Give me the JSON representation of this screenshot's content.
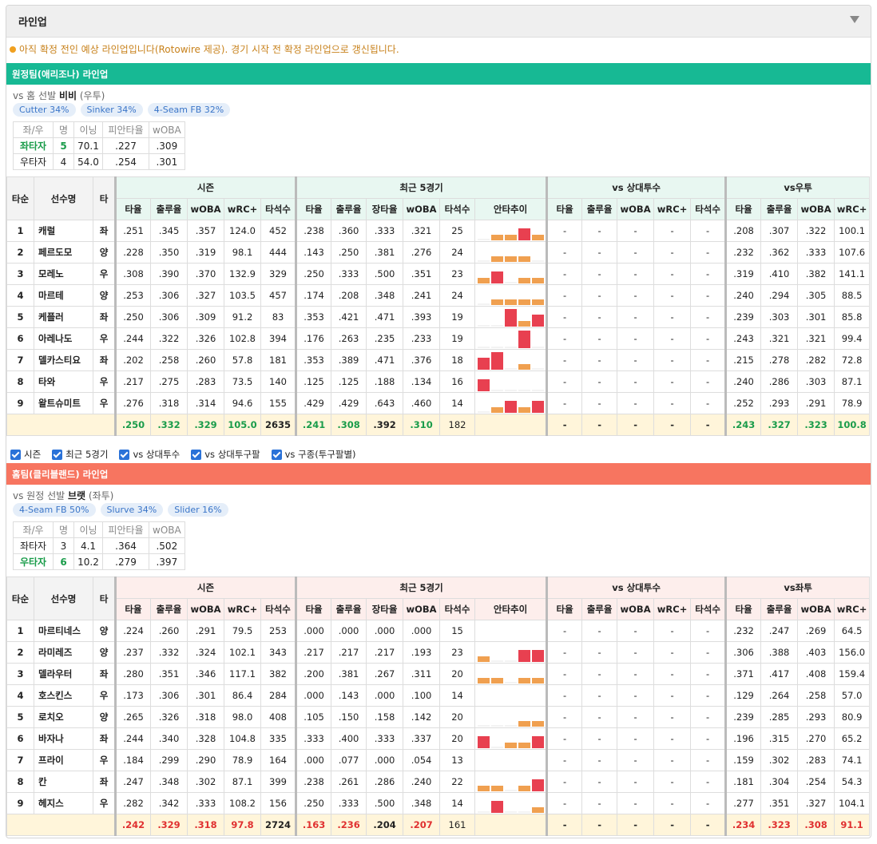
{
  "header": {
    "title": "라인업"
  },
  "notice": "아직 확정 전인 예상 라인업입니다(Rotowire 제공). 경기 시작 전 확정 라인업으로 갱신됩니다.",
  "filters": [
    "시즌",
    "최근 5경기",
    "vs 상대투수",
    "vs 상대투구팔",
    "vs 구종(투구팔별)"
  ],
  "colors": {
    "away_accent": "#17b994",
    "home_accent": "#f77560",
    "good": "#1a9c4a",
    "bad": "#e03030"
  },
  "table_headers": {
    "order": "타순",
    "player": "선수명",
    "bats": "타",
    "groups": [
      "시즌",
      "최근 5경기",
      "vs 상대투수"
    ],
    "season_cols": [
      "타율",
      "출루율",
      "wOBA",
      "wRC+",
      "타석수"
    ],
    "recent_cols": [
      "타율",
      "출루율",
      "장타율",
      "wOBA",
      "타석수",
      "안타추이"
    ],
    "vsp_cols": [
      "타율",
      "출루율",
      "wOBA",
      "wRC+",
      "타석수"
    ],
    "hand_cols": [
      "타율",
      "출루율",
      "wOBA",
      "wRC+"
    ],
    "split_cols": [
      "좌/우",
      "명",
      "이닝",
      "피안타율",
      "wOBA"
    ]
  },
  "away": {
    "title": "원정팀(애리조나) 라인업",
    "vs_prefix": "vs 홈 선발",
    "pitcher": "비비",
    "pitcher_hand": "(우투)",
    "pitches": [
      "Cutter 34%",
      "Sinker 34%",
      "4-Seam FB 32%"
    ],
    "hand_group": "vs우투",
    "splits": [
      {
        "side": "좌타자",
        "count": "5",
        "ip": "70.1",
        "avg": ".227",
        "woba": ".309",
        "highlight": true
      },
      {
        "side": "우타자",
        "count": "4",
        "ip": "54.0",
        "avg": ".254",
        "woba": ".301",
        "highlight": false
      }
    ],
    "players": [
      {
        "order": "1",
        "name": "캐럴",
        "bats": "좌",
        "season": [
          ".251",
          ".345",
          ".357",
          "124.0",
          "452"
        ],
        "recent": [
          ".238",
          ".360",
          ".333",
          ".321",
          "25"
        ],
        "trend": [
          0,
          1,
          1,
          2,
          1
        ],
        "vsp": [
          "-",
          "-",
          "-",
          "-",
          "-"
        ],
        "hand": [
          ".208",
          ".307",
          ".322",
          "100.1"
        ]
      },
      {
        "order": "2",
        "name": "페르도모",
        "bats": "양",
        "season": [
          ".228",
          ".350",
          ".319",
          "98.1",
          "444"
        ],
        "recent": [
          ".143",
          ".250",
          ".381",
          ".276",
          "24"
        ],
        "trend": [
          0,
          1,
          1,
          1,
          0
        ],
        "vsp": [
          "-",
          "-",
          "-",
          "-",
          "-"
        ],
        "hand": [
          ".232",
          ".362",
          ".333",
          "107.6"
        ]
      },
      {
        "order": "3",
        "name": "모레노",
        "bats": "우",
        "season": [
          ".308",
          ".390",
          ".370",
          "132.9",
          "329"
        ],
        "recent": [
          ".250",
          ".333",
          ".500",
          ".351",
          "23"
        ],
        "trend": [
          1,
          2,
          0,
          1,
          1
        ],
        "vsp": [
          "-",
          "-",
          "-",
          "-",
          "-"
        ],
        "hand": [
          ".319",
          ".410",
          ".382",
          "141.1"
        ]
      },
      {
        "order": "4",
        "name": "마르테",
        "bats": "양",
        "season": [
          ".253",
          ".306",
          ".327",
          "103.5",
          "457"
        ],
        "recent": [
          ".174",
          ".208",
          ".348",
          ".241",
          "24"
        ],
        "trend": [
          0,
          1,
          1,
          1,
          1
        ],
        "vsp": [
          "-",
          "-",
          "-",
          "-",
          "-"
        ],
        "hand": [
          ".240",
          ".294",
          ".305",
          "88.5"
        ]
      },
      {
        "order": "5",
        "name": "케플러",
        "bats": "좌",
        "season": [
          ".250",
          ".306",
          ".309",
          "91.2",
          "83"
        ],
        "recent": [
          ".353",
          ".421",
          ".471",
          ".393",
          "19"
        ],
        "trend": [
          0,
          0,
          3,
          1,
          2
        ],
        "vsp": [
          "-",
          "-",
          "-",
          "-",
          "-"
        ],
        "hand": [
          ".239",
          ".303",
          ".301",
          "85.8"
        ]
      },
      {
        "order": "6",
        "name": "아레나도",
        "bats": "우",
        "season": [
          ".244",
          ".322",
          ".326",
          "102.8",
          "394"
        ],
        "recent": [
          ".176",
          ".263",
          ".235",
          ".233",
          "19"
        ],
        "trend": [
          0,
          0,
          0,
          3,
          0
        ],
        "vsp": [
          "-",
          "-",
          "-",
          "-",
          "-"
        ],
        "hand": [
          ".243",
          ".321",
          ".321",
          "99.4"
        ]
      },
      {
        "order": "7",
        "name": "델카스티요",
        "bats": "좌",
        "season": [
          ".202",
          ".258",
          ".260",
          "57.8",
          "181"
        ],
        "recent": [
          ".353",
          ".389",
          ".471",
          ".376",
          "18"
        ],
        "trend": [
          2,
          3,
          0,
          1,
          0
        ],
        "vsp": [
          "-",
          "-",
          "-",
          "-",
          "-"
        ],
        "hand": [
          ".215",
          ".278",
          ".282",
          "72.8"
        ]
      },
      {
        "order": "8",
        "name": "타와",
        "bats": "우",
        "season": [
          ".217",
          ".275",
          ".283",
          "73.5",
          "140"
        ],
        "recent": [
          ".125",
          ".125",
          ".188",
          ".134",
          "16"
        ],
        "trend": [
          2,
          0,
          0,
          0,
          0
        ],
        "vsp": [
          "-",
          "-",
          "-",
          "-",
          "-"
        ],
        "hand": [
          ".240",
          ".286",
          ".303",
          "87.1"
        ]
      },
      {
        "order": "9",
        "name": "왈트슈미트",
        "bats": "우",
        "season": [
          ".276",
          ".318",
          ".314",
          "94.6",
          "155"
        ],
        "recent": [
          ".429",
          ".429",
          ".643",
          ".460",
          "14"
        ],
        "trend": [
          0,
          1,
          2,
          1,
          2
        ],
        "vsp": [
          "-",
          "-",
          "-",
          "-",
          "-"
        ],
        "hand": [
          ".252",
          ".293",
          ".291",
          "78.9"
        ]
      }
    ],
    "total": {
      "season": [
        ".250",
        ".332",
        ".329",
        "105.0",
        "2635"
      ],
      "recent": [
        ".241",
        ".308",
        ".392",
        ".310",
        "182"
      ],
      "vsp": [
        "-",
        "-",
        "-",
        "-",
        "-"
      ],
      "hand": [
        ".243",
        ".327",
        ".323",
        "100.8"
      ]
    }
  },
  "home": {
    "title": "홈팀(클리블랜드) 라인업",
    "vs_prefix": "vs 원정 선발",
    "pitcher": "브랫",
    "pitcher_hand": "(좌투)",
    "pitches": [
      "4-Seam FB 50%",
      "Slurve 34%",
      "Slider 16%"
    ],
    "hand_group": "vs좌투",
    "splits": [
      {
        "side": "좌타자",
        "count": "3",
        "ip": "4.1",
        "avg": ".364",
        "woba": ".502",
        "highlight": false
      },
      {
        "side": "우타자",
        "count": "6",
        "ip": "10.2",
        "avg": ".279",
        "woba": ".397",
        "highlight": true
      }
    ],
    "players": [
      {
        "order": "1",
        "name": "마르티네스",
        "bats": "양",
        "season": [
          ".224",
          ".260",
          ".291",
          "79.5",
          "253"
        ],
        "recent": [
          ".000",
          ".000",
          ".000",
          ".000",
          "15"
        ],
        "trend": [
          -1,
          -1,
          -1,
          -1,
          -1
        ],
        "vsp": [
          "-",
          "-",
          "-",
          "-",
          "-"
        ],
        "hand": [
          ".232",
          ".247",
          ".269",
          "64.5"
        ]
      },
      {
        "order": "2",
        "name": "라미레즈",
        "bats": "양",
        "season": [
          ".237",
          ".332",
          ".324",
          "102.1",
          "343"
        ],
        "recent": [
          ".217",
          ".217",
          ".217",
          ".193",
          "23"
        ],
        "trend": [
          1,
          0,
          0,
          2,
          2
        ],
        "vsp": [
          "-",
          "-",
          "-",
          "-",
          "-"
        ],
        "hand": [
          ".306",
          ".388",
          ".403",
          "156.0"
        ]
      },
      {
        "order": "3",
        "name": "델라우터",
        "bats": "좌",
        "season": [
          ".280",
          ".351",
          ".346",
          "117.1",
          "382"
        ],
        "recent": [
          ".200",
          ".381",
          ".267",
          ".311",
          "20"
        ],
        "trend": [
          1,
          1,
          0,
          1,
          1
        ],
        "vsp": [
          "-",
          "-",
          "-",
          "-",
          "-"
        ],
        "hand": [
          ".371",
          ".417",
          ".408",
          "159.4"
        ]
      },
      {
        "order": "4",
        "name": "호스킨스",
        "bats": "우",
        "season": [
          ".173",
          ".306",
          ".301",
          "86.4",
          "284"
        ],
        "recent": [
          ".000",
          ".143",
          ".000",
          ".100",
          "14"
        ],
        "trend": [
          -1,
          -1,
          -1,
          -1,
          -1
        ],
        "vsp": [
          "-",
          "-",
          "-",
          "-",
          "-"
        ],
        "hand": [
          ".129",
          ".264",
          ".258",
          "57.0"
        ]
      },
      {
        "order": "5",
        "name": "로치오",
        "bats": "양",
        "season": [
          ".265",
          ".326",
          ".318",
          "98.0",
          "408"
        ],
        "recent": [
          ".105",
          ".150",
          ".158",
          ".142",
          "20"
        ],
        "trend": [
          0,
          0,
          0,
          1,
          1
        ],
        "vsp": [
          "-",
          "-",
          "-",
          "-",
          "-"
        ],
        "hand": [
          ".239",
          ".285",
          ".293",
          "80.9"
        ]
      },
      {
        "order": "6",
        "name": "바자나",
        "bats": "좌",
        "season": [
          ".244",
          ".340",
          ".328",
          "104.8",
          "335"
        ],
        "recent": [
          ".333",
          ".400",
          ".333",
          ".337",
          "20"
        ],
        "trend": [
          2,
          0,
          1,
          1,
          2
        ],
        "vsp": [
          "-",
          "-",
          "-",
          "-",
          "-"
        ],
        "hand": [
          ".196",
          ".315",
          ".270",
          "65.2"
        ]
      },
      {
        "order": "7",
        "name": "프라이",
        "bats": "우",
        "season": [
          ".184",
          ".299",
          ".290",
          "78.9",
          "164"
        ],
        "recent": [
          ".000",
          ".077",
          ".000",
          ".054",
          "13"
        ],
        "trend": [
          -1,
          -1,
          -1,
          -1,
          -1
        ],
        "vsp": [
          "-",
          "-",
          "-",
          "-",
          "-"
        ],
        "hand": [
          ".159",
          ".302",
          ".283",
          "74.1"
        ]
      },
      {
        "order": "8",
        "name": "칸",
        "bats": "좌",
        "season": [
          ".247",
          ".348",
          ".302",
          "87.1",
          "399"
        ],
        "recent": [
          ".238",
          ".261",
          ".286",
          ".240",
          "22"
        ],
        "trend": [
          1,
          1,
          0,
          1,
          2
        ],
        "vsp": [
          "-",
          "-",
          "-",
          "-",
          "-"
        ],
        "hand": [
          ".181",
          ".304",
          ".254",
          "54.3"
        ]
      },
      {
        "order": "9",
        "name": "헤지스",
        "bats": "우",
        "season": [
          ".282",
          ".342",
          ".333",
          "108.2",
          "156"
        ],
        "recent": [
          ".250",
          ".333",
          ".500",
          ".348",
          "14"
        ],
        "trend": [
          0,
          2,
          0,
          0,
          1
        ],
        "vsp": [
          "-",
          "-",
          "-",
          "-",
          "-"
        ],
        "hand": [
          ".277",
          ".351",
          ".327",
          "104.1"
        ]
      }
    ],
    "total": {
      "season": [
        ".242",
        ".329",
        ".318",
        "97.8",
        "2724"
      ],
      "recent": [
        ".163",
        ".236",
        ".204",
        ".207",
        "161"
      ],
      "vsp": [
        "-",
        "-",
        "-",
        "-",
        "-"
      ],
      "hand": [
        ".234",
        ".323",
        ".308",
        "91.1"
      ]
    }
  }
}
